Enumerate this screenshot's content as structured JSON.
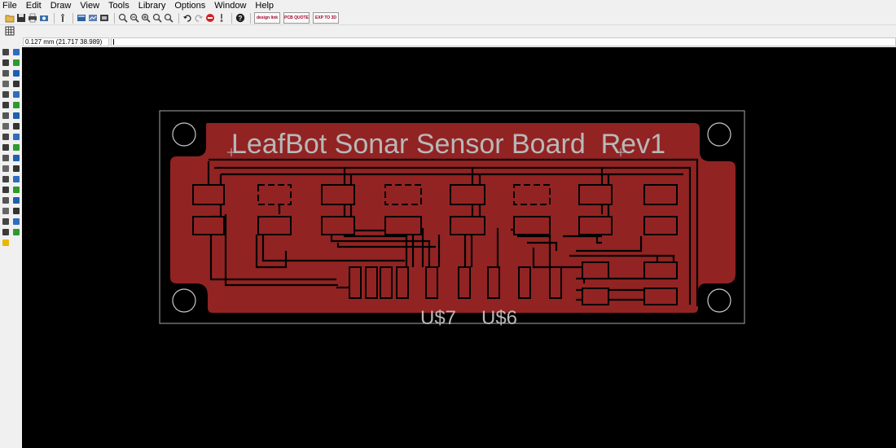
{
  "menu": [
    "File",
    "Edit",
    "Draw",
    "View",
    "Tools",
    "Library",
    "Options",
    "Window",
    "Help"
  ],
  "toolbar": {
    "icons": [
      "open-icon",
      "save-icon",
      "print-icon",
      "cam-icon",
      "script-icon",
      "board-icon",
      "schematic-icon",
      "zoom-fit-icon",
      "zoom-in-icon",
      "zoom-out-icon",
      "zoom-select-icon",
      "zoom-redraw-icon",
      "undo-icon",
      "redo-icon",
      "stop-icon",
      "go-icon",
      "help-icon"
    ],
    "web_buttons": [
      "design link",
      "PCB QUOTE",
      "EXP TO 3D"
    ]
  },
  "coordinates": "0.127 mm (21.717 38.989)",
  "command": "",
  "board": {
    "title_text": "LeafBot Sonar Sensor Board  Rev1",
    "label_u7": "U$7",
    "label_u6": "U$6",
    "copper_color": "#922323",
    "outline_color": "#a8a8a8",
    "silk_color": "#b8b8b8"
  },
  "sidebar_tools": [
    "info-icon",
    "show-icon",
    "display-icon",
    "mark-icon",
    "move-icon",
    "copy-icon",
    "mirror-icon",
    "rotate-icon",
    "group-icon",
    "change-icon",
    "paste-icon",
    "delete-icon",
    "add-icon",
    "replace-icon",
    "lock-icon",
    "name-icon",
    "value-icon",
    "smash-icon",
    "split-icon",
    "optimize-icon",
    "route-icon",
    "ripup-icon",
    "wire-icon",
    "text-icon",
    "circle-icon",
    "arc-icon",
    "rect-icon",
    "polygon-icon",
    "via-icon",
    "signal-icon",
    "hole-icon",
    "attribute-icon",
    "dimension-icon",
    "ratsnest-icon",
    "autorouter-icon",
    "drc-icon",
    "errors-icon"
  ]
}
